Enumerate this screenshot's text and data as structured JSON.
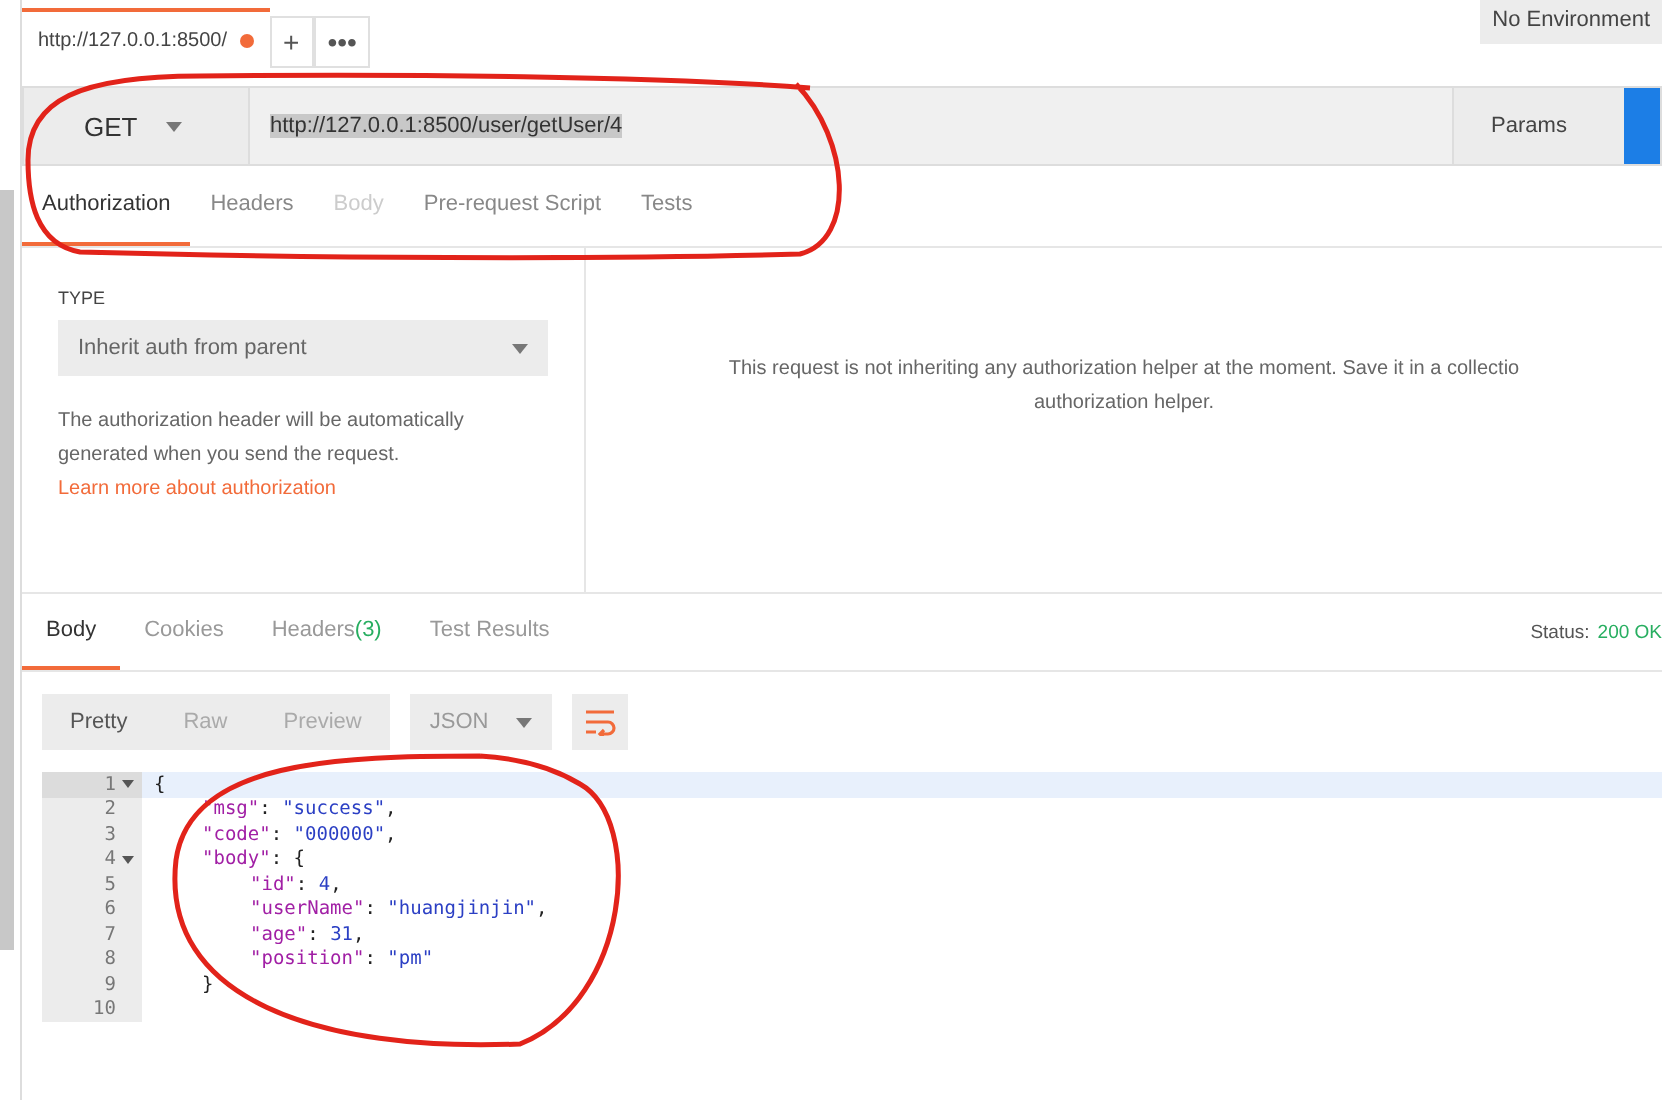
{
  "request_tab": {
    "title": "http://127.0.0.1:8500/",
    "unsaved": true
  },
  "tab_actions": [
    "+",
    "•••"
  ],
  "environment": {
    "value": "No Environment"
  },
  "request": {
    "method": "GET",
    "url": "http://127.0.0.1:8500/user/getUser/4",
    "params_label": "Params"
  },
  "request_tabs": [
    {
      "label": "Authorization",
      "selected": true,
      "disabled": false
    },
    {
      "label": "Headers",
      "selected": false,
      "disabled": false
    },
    {
      "label": "Body",
      "selected": false,
      "disabled": true
    },
    {
      "label": "Pre-request Script",
      "selected": false,
      "disabled": false
    },
    {
      "label": "Tests",
      "selected": false,
      "disabled": false
    }
  ],
  "auth": {
    "type_label": "TYPE",
    "type_value": "Inherit auth from parent",
    "description": "The authorization header will be automatically generated when you send the request.",
    "link": "Learn more about authorization",
    "message_line1": "This request is not inheriting any authorization helper at the moment. Save it in a collectio",
    "message_line2": "authorization helper."
  },
  "response_tabs": [
    {
      "label": "Body",
      "selected": true
    },
    {
      "label": "Cookies",
      "selected": false
    },
    {
      "label": "Headers",
      "count": "(3)",
      "selected": false
    },
    {
      "label": "Test Results",
      "selected": false
    }
  ],
  "status": {
    "label": "Status:",
    "value": "200 OK"
  },
  "view_modes": [
    {
      "label": "Pretty",
      "selected": true
    },
    {
      "label": "Raw",
      "selected": false
    },
    {
      "label": "Preview",
      "selected": false
    }
  ],
  "format": "JSON",
  "code_lines": [
    {
      "number": "1",
      "foldable": true,
      "active": true,
      "tokens": [
        {
          "kind": "punct",
          "text": "{"
        }
      ],
      "children": [
        {
          "number": "2",
          "foldable": false,
          "active": false,
          "tokens": [
            {
              "kind": "key",
              "text": "\"msg\""
            },
            {
              "kind": "punct",
              "text": ": "
            },
            {
              "kind": "string",
              "text": "\"success\""
            },
            {
              "kind": "punct",
              "text": ","
            }
          ]
        },
        {
          "number": "3",
          "foldable": false,
          "active": false,
          "tokens": [
            {
              "kind": "key",
              "text": "\"code\""
            },
            {
              "kind": "punct",
              "text": ": "
            },
            {
              "kind": "string",
              "text": "\"000000\""
            },
            {
              "kind": "punct",
              "text": ","
            }
          ]
        },
        {
          "number": "4",
          "foldable": true,
          "active": false,
          "tokens": [
            {
              "kind": "key",
              "text": "\"body\""
            },
            {
              "kind": "punct",
              "text": ": {"
            }
          ],
          "children": [
            {
              "number": "5",
              "foldable": false,
              "active": false,
              "tokens": [
                {
                  "kind": "key",
                  "text": "\"id\""
                },
                {
                  "kind": "punct",
                  "text": ": "
                },
                {
                  "kind": "number",
                  "text": "4"
                },
                {
                  "kind": "punct",
                  "text": ","
                }
              ]
            },
            {
              "number": "6",
              "foldable": false,
              "active": false,
              "tokens": [
                {
                  "kind": "key",
                  "text": "\"userName\""
                },
                {
                  "kind": "punct",
                  "text": ": "
                },
                {
                  "kind": "string",
                  "text": "\"huangjinjin\""
                },
                {
                  "kind": "punct",
                  "text": ","
                }
              ]
            },
            {
              "number": "7",
              "foldable": false,
              "active": false,
              "tokens": [
                {
                  "kind": "key",
                  "text": "\"age\""
                },
                {
                  "kind": "punct",
                  "text": ": "
                },
                {
                  "kind": "number",
                  "text": "31"
                },
                {
                  "kind": "punct",
                  "text": ","
                }
              ]
            },
            {
              "number": "8",
              "foldable": false,
              "active": false,
              "tokens": [
                {
                  "kind": "key",
                  "text": "\"position\""
                },
                {
                  "kind": "punct",
                  "text": ": "
                },
                {
                  "kind": "string",
                  "text": "\"pm\""
                }
              ]
            }
          ]
        },
        {
          "number": "9",
          "foldable": false,
          "active": false,
          "tokens": [
            {
              "kind": "punct",
              "text": "}"
            }
          ]
        }
      ]
    },
    {
      "number": "10",
      "foldable": false,
      "active": false
    }
  ]
}
